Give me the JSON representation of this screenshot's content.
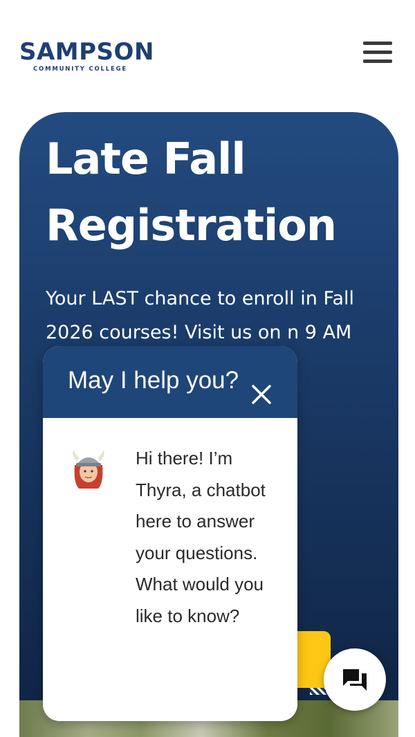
{
  "header": {
    "logo_main": "SAMPSON",
    "logo_sub": "COMMUNITY COLLEGE",
    "menu_icon": "hamburger-menu-icon"
  },
  "hero": {
    "title_line1": "Late Fall",
    "title_line2": "Registration",
    "text": "Your LAST chance to enroll in Fall 2026 courses! Visit us on                           n 9 AM                                        tor                                             your                                         es, find",
    "cta_icon": "arrow-right-icon"
  },
  "chat": {
    "title": "May I help you?",
    "close_icon": "close-icon",
    "avatar_icon": "viking-avatar-icon",
    "message": "Hi there! I’m Thyra, a chatbot here to answer your questions. What would you like to know?"
  },
  "chat_launcher": {
    "icon": "chat-bubbles-icon"
  },
  "colors": {
    "brand_navy": "#1f3f73",
    "hero_navy": "#1b3c6a",
    "accent_gold": "#ffc715",
    "chat_header": "#1f4679"
  }
}
